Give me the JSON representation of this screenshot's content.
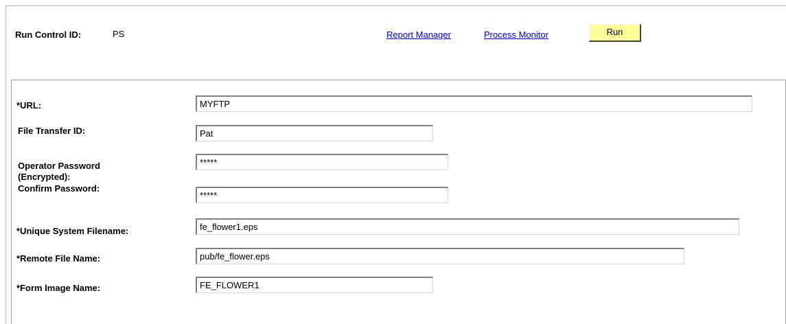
{
  "header": {
    "run_control_label": "Run Control ID:",
    "run_control_value": "PS",
    "report_manager_link": "Report Manager",
    "process_monitor_link": "Process Monitor",
    "run_button": "Run"
  },
  "form": {
    "url_label": "*URL:",
    "url_value": "MYFTP",
    "file_transfer_label": "File Transfer ID:",
    "file_transfer_value": "Pat",
    "operator_password_label_line1": "Operator Password",
    "operator_password_label_line2": "(Encrypted):",
    "operator_password_value": "*****",
    "confirm_password_label": "Confirm Password:",
    "confirm_password_value": "*****",
    "unique_filename_label": "*Unique System Filename:",
    "unique_filename_value": "fe_flower1.eps",
    "remote_file_label": "*Remote File Name:",
    "remote_file_value": "pub/fe_flower.eps",
    "form_image_label": "*Form Image Name:",
    "form_image_value": "FE_FLOWER1"
  }
}
